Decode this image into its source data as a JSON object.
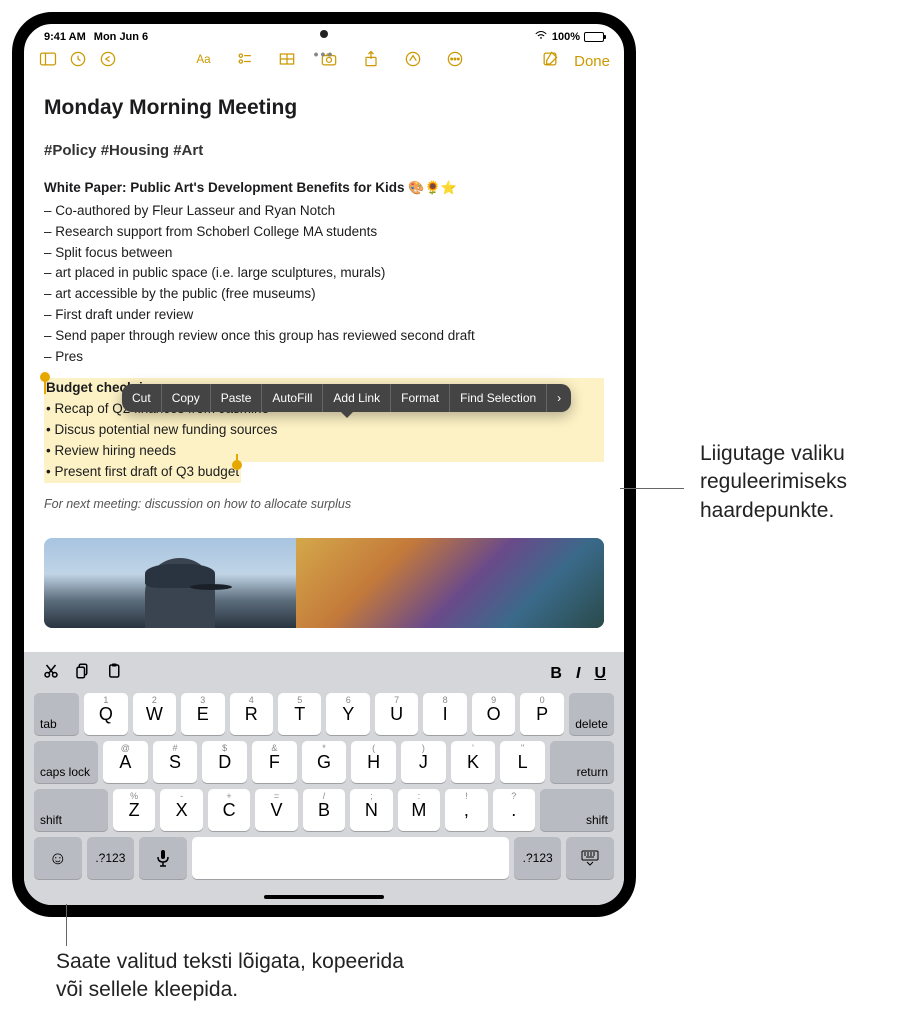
{
  "status": {
    "time": "9:41 AM",
    "date": "Mon Jun 6",
    "battery": "100%"
  },
  "toolbar": {
    "done": "Done"
  },
  "note": {
    "title": "Monday Morning Meeting",
    "tags": "#Policy #Housing #Art",
    "white_paper_head": "White Paper: Public Art's Development Benefits for Kids",
    "emojis": "🎨🌻⭐",
    "bullets": [
      "– Co-authored by Fleur Lasseur and Ryan Notch",
      "– Research support from Schoberl College MA students",
      "– Split focus between",
      "– art placed in public space (i.e. large sculptures, murals)",
      "– art accessible by the public (free museums)",
      "– First draft under review",
      "– Send paper through review once this group has reviewed second draft",
      "– Pres"
    ],
    "selection": {
      "head": "Budget check-in",
      "items": [
        "• Recap of Q2 finances from Jasmine",
        "• Discus potential new funding sources",
        "• Review hiring needs",
        "• Present first draft of Q3 budget"
      ]
    },
    "italic_line": "For next meeting: discussion on how to allocate surplus"
  },
  "context_menu": [
    "Cut",
    "Copy",
    "Paste",
    "AutoFill",
    "Add Link",
    "Format",
    "Find Selection"
  ],
  "keyboard": {
    "format": {
      "b": "B",
      "i": "I",
      "u": "U"
    },
    "row1_sub": [
      "1",
      "2",
      "3",
      "4",
      "5",
      "6",
      "7",
      "8",
      "9",
      "0"
    ],
    "row1": [
      "Q",
      "W",
      "E",
      "R",
      "T",
      "Y",
      "U",
      "I",
      "O",
      "P"
    ],
    "row2_sub": [
      "@",
      "#",
      "$",
      "&",
      "*",
      "(",
      ")",
      "'",
      "\""
    ],
    "row2": [
      "A",
      "S",
      "D",
      "F",
      "G",
      "H",
      "J",
      "K",
      "L"
    ],
    "row3_sub": [
      "%",
      "-",
      "+",
      "=",
      "/",
      ";",
      ":",
      "!",
      "?"
    ],
    "row3": [
      "Z",
      "X",
      "C",
      "V",
      "B",
      "N",
      "M",
      ",",
      "."
    ],
    "tab": "tab",
    "delete": "delete",
    "caps": "caps lock",
    "return": "return",
    "shift": "shift",
    "num": ".?123"
  },
  "callouts": {
    "c1": "Liigutage valiku reguleerimiseks haardepunkte.",
    "c2": "Saate valitud teksti lõigata, kopeerida või sellele kleepida."
  }
}
